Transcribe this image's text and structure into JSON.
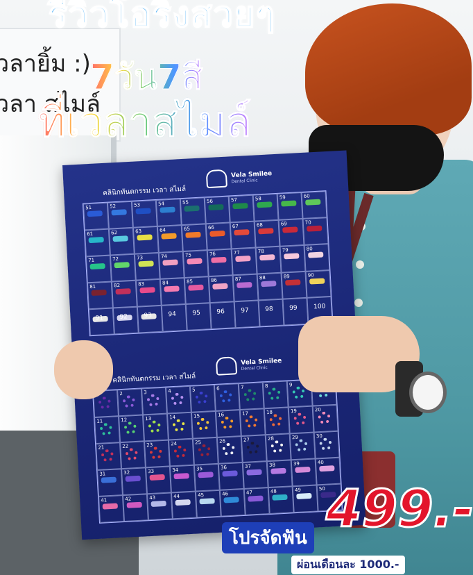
{
  "headline": {
    "top": "รีวิวโอริงสวยๆ",
    "line1": "7วัน7สี",
    "line2": "ที่เวลาสไมล์"
  },
  "wall_sign": {
    "line1": "วลายิ้ม :)",
    "line2": "วลา สไมล์"
  },
  "boards": [
    {
      "brand": "Vela Smilee",
      "brand_sub": "Dental Clinic",
      "clinic_name": "คลินิกทันตกรรม เวลา สไมล์",
      "start": 51,
      "cells": [
        {
          "n": "51",
          "c": "#2a5bd7"
        },
        {
          "n": "52",
          "c": "#3478e0"
        },
        {
          "n": "53",
          "c": "#1f4fc4"
        },
        {
          "n": "54",
          "c": "#2d7fd0"
        },
        {
          "n": "55",
          "c": "#1b6f6f"
        },
        {
          "n": "56",
          "c": "#146b5a"
        },
        {
          "n": "57",
          "c": "#1f8a4a"
        },
        {
          "n": "58",
          "c": "#2fa84f"
        },
        {
          "n": "59",
          "c": "#47b84a"
        },
        {
          "n": "60",
          "c": "#5fc75a"
        },
        {
          "n": "61",
          "c": "#27b6c9"
        },
        {
          "n": "62",
          "c": "#59c9e0"
        },
        {
          "n": "63",
          "c": "#e7e046"
        },
        {
          "n": "64",
          "c": "#f29a2a"
        },
        {
          "n": "65",
          "c": "#f07a2a"
        },
        {
          "n": "66",
          "c": "#ea5b2a"
        },
        {
          "n": "67",
          "c": "#e34a3a"
        },
        {
          "n": "68",
          "c": "#d93a3a"
        },
        {
          "n": "69",
          "c": "#c92a3a"
        },
        {
          "n": "70",
          "c": "#b8203a"
        },
        {
          "n": "71",
          "c": "#26c48a"
        },
        {
          "n": "72",
          "c": "#62d66a"
        },
        {
          "n": "73",
          "c": "#cfe255"
        },
        {
          "n": "74",
          "c": "#f2a0c0"
        },
        {
          "n": "75",
          "c": "#f58ab5"
        },
        {
          "n": "76",
          "c": "#ef6fa5"
        },
        {
          "n": "77",
          "c": "#f2a2c6"
        },
        {
          "n": "78",
          "c": "#f3b8d3"
        },
        {
          "n": "79",
          "c": "#f6c9dc"
        },
        {
          "n": "80",
          "c": "#f1d5e2"
        },
        {
          "n": "81",
          "c": "#7a2230"
        },
        {
          "n": "82",
          "c": "#c2305a"
        },
        {
          "n": "83",
          "c": "#e84b8b"
        },
        {
          "n": "84",
          "c": "#f47bb0"
        },
        {
          "n": "85",
          "c": "#e45aa0"
        },
        {
          "n": "86",
          "c": "#f0a3c5"
        },
        {
          "n": "87",
          "c": "#ba6bd0"
        },
        {
          "n": "88",
          "c": "#9e78d8"
        },
        {
          "n": "89",
          "c": "#c53035"
        },
        {
          "n": "90",
          "c": "#f0d25a"
        },
        {
          "n": "",
          "c": "#e8e8e8"
        },
        {
          "n": "",
          "c": "#d8d8f0"
        },
        {
          "n": "",
          "c": "#e6e6e6"
        },
        {
          "n": "",
          "c": ""
        },
        {
          "n": "",
          "c": ""
        },
        {
          "n": "",
          "c": ""
        },
        {
          "n": "",
          "c": ""
        },
        {
          "n": "",
          "c": ""
        },
        {
          "n": "",
          "c": ""
        },
        {
          "n": "",
          "c": ""
        }
      ],
      "empty_labels": [
        "91",
        "92",
        "93",
        "94",
        "95",
        "96",
        "97",
        "98",
        "99",
        "100"
      ]
    },
    {
      "brand": "Vela Smilee",
      "brand_sub": "Dental Clinic",
      "clinic_name": "คลินิกทันตกรรม เวลา สไมล์",
      "start": 1,
      "cells": [
        {
          "n": "1",
          "c": "#6a2aa8"
        },
        {
          "n": "2",
          "c": "#8a5ad8"
        },
        {
          "n": "3",
          "c": "#a77be8"
        },
        {
          "n": "4",
          "c": "#b590f0"
        },
        {
          "n": "5",
          "c": "#3a3fcf"
        },
        {
          "n": "6",
          "c": "#2f5fe0"
        },
        {
          "n": "7",
          "c": "#1f8a6a"
        },
        {
          "n": "8",
          "c": "#27b08a"
        },
        {
          "n": "9",
          "c": "#35c7b4"
        },
        {
          "n": "10",
          "c": "#6fd8d8"
        },
        {
          "n": "11",
          "c": "#2fbf9a"
        },
        {
          "n": "12",
          "c": "#56d070"
        },
        {
          "n": "13",
          "c": "#9ede4a"
        },
        {
          "n": "14",
          "c": "#e7e446"
        },
        {
          "n": "15",
          "c": "#f2c23a"
        },
        {
          "n": "16",
          "c": "#f29a2a"
        },
        {
          "n": "17",
          "c": "#f07a32"
        },
        {
          "n": "18",
          "c": "#ea6a3a"
        },
        {
          "n": "19",
          "c": "#e45a8a"
        },
        {
          "n": "20",
          "c": "#f08ab8"
        },
        {
          "n": "21",
          "c": "#c4305a"
        },
        {
          "n": "22",
          "c": "#e54a6a"
        },
        {
          "n": "23",
          "c": "#d83a3a"
        },
        {
          "n": "24",
          "c": "#c32a3a"
        },
        {
          "n": "25",
          "c": "#9a2238"
        },
        {
          "n": "26",
          "c": "#eef0f5"
        },
        {
          "n": "27",
          "c": "#1a1a3a"
        },
        {
          "n": "28",
          "c": "#f2f2f2"
        },
        {
          "n": "29",
          "c": "#a9cbe8"
        },
        {
          "n": "30",
          "c": "#c7d6ec"
        },
        {
          "n": "31",
          "c": "#3a6fd8"
        },
        {
          "n": "32",
          "c": "#6a4fd0"
        },
        {
          "n": "33",
          "c": "#e3558f"
        },
        {
          "n": "34",
          "c": "#c85ad0"
        },
        {
          "n": "35",
          "c": "#9a5ad8"
        },
        {
          "n": "36",
          "c": "#6b5adb"
        },
        {
          "n": "37",
          "c": "#8a6ae0"
        },
        {
          "n": "38",
          "c": "#b67ae2"
        },
        {
          "n": "39",
          "c": "#d58ad8"
        },
        {
          "n": "40",
          "c": "#e0a2e0"
        },
        {
          "n": "41",
          "c": "#e66aa8"
        },
        {
          "n": "42",
          "c": "#d05ac0"
        },
        {
          "n": "43",
          "c": "#b3b8e8"
        },
        {
          "n": "44",
          "c": "#d5d8f0"
        },
        {
          "n": "45",
          "c": "#b8d8f0"
        },
        {
          "n": "46",
          "c": "#2f8ad8"
        },
        {
          "n": "47",
          "c": "#8a5ad8"
        },
        {
          "n": "48",
          "c": "#2fb0c8"
        },
        {
          "n": "49",
          "c": "#d8ecf8"
        },
        {
          "n": "50",
          "c": "#3a2a8a"
        }
      ]
    }
  ],
  "promo": {
    "label": "โปรจัดฟัน",
    "price": "499.-",
    "installment": "ผ่อนเดือนละ 1000.-"
  }
}
